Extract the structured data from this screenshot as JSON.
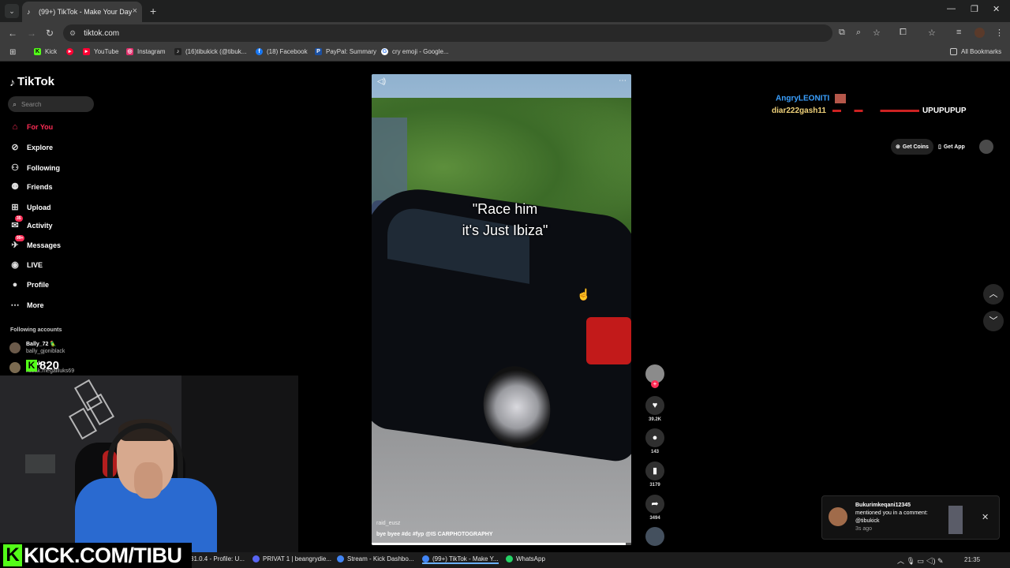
{
  "browser": {
    "tab": {
      "title": "(99+) TikTok - Make Your Day",
      "icon": "tiktok-icon"
    },
    "url": "tiktok.com",
    "bookmarks": [
      {
        "label": "Kick",
        "color": "#53fc18"
      },
      {
        "label": "",
        "color": "#ff0033"
      },
      {
        "label": "YouTube",
        "color": "#ff0033"
      },
      {
        "label": "Instagram",
        "color": "#e1306c"
      },
      {
        "label": "(16)tibukick (@tibuk...",
        "color": "#222222"
      },
      {
        "label": "(18) Facebook",
        "color": "#1877f2"
      },
      {
        "label": "PayPal: Summary",
        "color": "#1b4fa0"
      },
      {
        "label": "cry emoji - Google...",
        "color": "#ffffff"
      }
    ],
    "all_bookmarks": "All Bookmarks"
  },
  "sidebar": {
    "logo": "TikTok",
    "search_placeholder": "Search",
    "nav": [
      {
        "label": "For You",
        "icon": "home-icon",
        "glyph": "⌂",
        "active": true
      },
      {
        "label": "Explore",
        "icon": "compass-icon",
        "glyph": "⊘"
      },
      {
        "label": "Following",
        "icon": "following-icon",
        "glyph": "⚇"
      },
      {
        "label": "Friends",
        "icon": "friends-icon",
        "glyph": "⚉"
      },
      {
        "label": "Upload",
        "icon": "upload-icon",
        "glyph": "⊞"
      },
      {
        "label": "Activity",
        "icon": "activity-icon",
        "glyph": "✉",
        "badge": "35"
      },
      {
        "label": "Messages",
        "icon": "messages-icon",
        "glyph": "✈",
        "badge": "99+"
      },
      {
        "label": "LIVE",
        "icon": "live-icon",
        "glyph": "◉"
      },
      {
        "label": "Profile",
        "icon": "profile-icon",
        "glyph": "●"
      },
      {
        "label": "More",
        "icon": "more-icon",
        "glyph": "⋯"
      }
    ],
    "following_title": "Following accounts",
    "accounts": [
      {
        "username": "Bally_72 🦜",
        "display": "bally_gjoniblack"
      },
      {
        "username": "kozak",
        "display": "kozak.megallluks69"
      }
    ]
  },
  "overlay": {
    "kick_count": "820",
    "kick_banner": "KICK.COM/TIBU"
  },
  "video": {
    "caption_line1": "\"Race him",
    "caption_line2": "it's Just Ibiza\"",
    "author": "raid_eusz",
    "description": "bye byee #dc #fyp  @IS CARPHOTOGRAPHY",
    "progress": 0.98
  },
  "actions": {
    "likes": "39.2K",
    "comments": "143",
    "saves": "3179",
    "shares": "3494"
  },
  "header_right": {
    "get_coins": "Get Coins",
    "get_app": "Get App"
  },
  "chat": [
    {
      "user": "AngryLEONITI",
      "color": "#3aa0ff"
    },
    {
      "user": "diar222gash11",
      "color": "#f0d27a",
      "message": "UPUPUPUP"
    }
  ],
  "notification": {
    "user": "Bukurimkeqani12345",
    "text": "mentioned you in a comment: @tibukick",
    "time": "3s ago"
  },
  "taskbar": {
    "apps": [
      {
        "label": "31.0.4 - Profile: U...",
        "color": "#3b8fd8"
      },
      {
        "label": "PRIVAT 1 | beangrydie...",
        "color": "#5865f2"
      },
      {
        "label": "Stream - Kick Dashbo...",
        "color": "#4285f4"
      },
      {
        "label": "(99+) TikTok - Make Y...",
        "color": "#4285f4",
        "active": true
      },
      {
        "label": "WhatsApp",
        "color": "#25d366"
      }
    ],
    "clock": "21:35"
  }
}
